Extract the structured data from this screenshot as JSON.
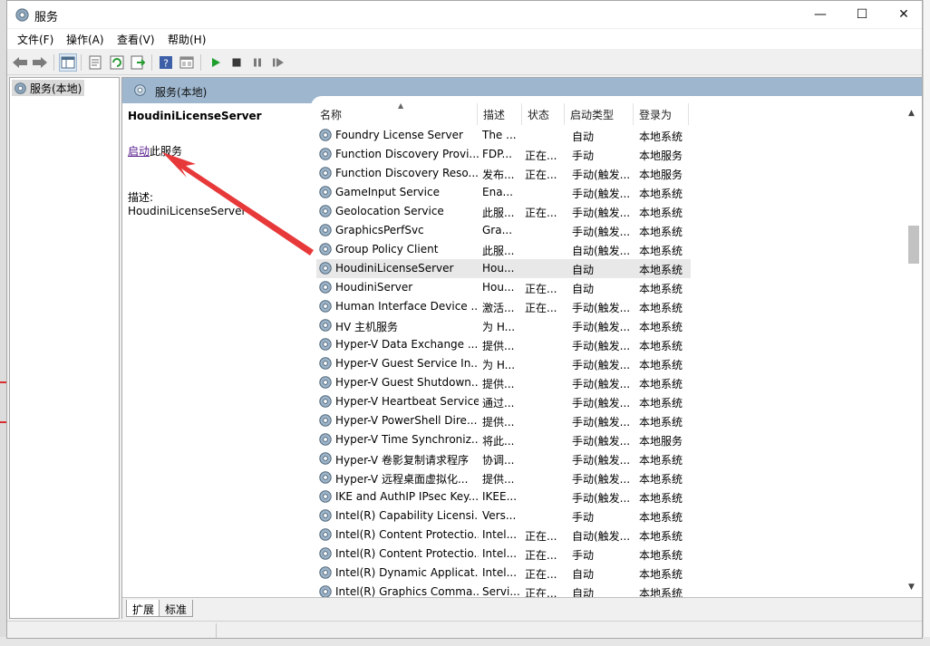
{
  "window": {
    "title": "服务"
  },
  "titlebar_buttons": {
    "minimize": "—",
    "maximize": "☐",
    "close": "✕"
  },
  "menu": [
    {
      "label": "文件(F)"
    },
    {
      "label": "操作(A)"
    },
    {
      "label": "查看(V)"
    },
    {
      "label": "帮助(H)"
    }
  ],
  "toolbar": {
    "icons": [
      "back-icon",
      "forward-icon",
      "show-hide-tree-icon",
      "properties-icon",
      "refresh-icon",
      "export-list-icon",
      "help-icon",
      "view-icon",
      "start-service-icon",
      "stop-service-icon",
      "pause-service-icon",
      "restart-service-icon"
    ]
  },
  "tree": {
    "root": "服务(本地)"
  },
  "pane": {
    "header": "服务(本地)"
  },
  "detail": {
    "service_name": "HoudiniLicenseServer",
    "action_link": "启动",
    "action_suffix": "此服务",
    "desc_label": "描述:",
    "desc_value": "HoudiniLicenseServer"
  },
  "columns": {
    "name": "名称",
    "desc": "描述",
    "status": "状态",
    "startup": "启动类型",
    "logon": "登录为"
  },
  "rows": [
    {
      "name": "Foundry License Server",
      "desc": "The ...",
      "status": "",
      "startup": "自动",
      "logon": "本地系统"
    },
    {
      "name": "Function Discovery Provi...",
      "desc": "FDP...",
      "status": "正在...",
      "startup": "手动",
      "logon": "本地服务"
    },
    {
      "name": "Function Discovery Reso...",
      "desc": "发布...",
      "status": "正在...",
      "startup": "手动(触发...",
      "logon": "本地服务"
    },
    {
      "name": "GameInput Service",
      "desc": "Ena...",
      "status": "",
      "startup": "手动(触发...",
      "logon": "本地系统"
    },
    {
      "name": "Geolocation Service",
      "desc": "此服...",
      "status": "正在...",
      "startup": "手动(触发...",
      "logon": "本地系统"
    },
    {
      "name": "GraphicsPerfSvc",
      "desc": "Gra...",
      "status": "",
      "startup": "手动(触发...",
      "logon": "本地系统"
    },
    {
      "name": "Group Policy Client",
      "desc": "此服...",
      "status": "",
      "startup": "自动(触发...",
      "logon": "本地系统"
    },
    {
      "name": "HoudiniLicenseServer",
      "desc": "Hou...",
      "status": "",
      "startup": "自动",
      "logon": "本地系统"
    },
    {
      "name": "HoudiniServer",
      "desc": "Hou...",
      "status": "正在...",
      "startup": "自动",
      "logon": "本地系统"
    },
    {
      "name": "Human Interface Device ...",
      "desc": "激活...",
      "status": "正在...",
      "startup": "手动(触发...",
      "logon": "本地系统"
    },
    {
      "name": "HV 主机服务",
      "desc": "为 H...",
      "status": "",
      "startup": "手动(触发...",
      "logon": "本地系统"
    },
    {
      "name": "Hyper-V Data Exchange ...",
      "desc": "提供...",
      "status": "",
      "startup": "手动(触发...",
      "logon": "本地系统"
    },
    {
      "name": "Hyper-V Guest Service In...",
      "desc": "为 H...",
      "status": "",
      "startup": "手动(触发...",
      "logon": "本地系统"
    },
    {
      "name": "Hyper-V Guest Shutdown...",
      "desc": "提供...",
      "status": "",
      "startup": "手动(触发...",
      "logon": "本地系统"
    },
    {
      "name": "Hyper-V Heartbeat Service",
      "desc": "通过...",
      "status": "",
      "startup": "手动(触发...",
      "logon": "本地系统"
    },
    {
      "name": "Hyper-V PowerShell Dire...",
      "desc": "提供...",
      "status": "",
      "startup": "手动(触发...",
      "logon": "本地系统"
    },
    {
      "name": "Hyper-V Time Synchroniz...",
      "desc": "将此...",
      "status": "",
      "startup": "手动(触发...",
      "logon": "本地服务"
    },
    {
      "name": "Hyper-V 卷影复制请求程序",
      "desc": "协调...",
      "status": "",
      "startup": "手动(触发...",
      "logon": "本地系统"
    },
    {
      "name": "Hyper-V 远程桌面虚拟化...",
      "desc": "提供...",
      "status": "",
      "startup": "手动(触发...",
      "logon": "本地系统"
    },
    {
      "name": "IKE and AuthIP IPsec Key...",
      "desc": "IKEE...",
      "status": "",
      "startup": "手动(触发...",
      "logon": "本地系统"
    },
    {
      "name": "Intel(R) Capability Licensi...",
      "desc": "Vers...",
      "status": "",
      "startup": "手动",
      "logon": "本地系统"
    },
    {
      "name": "Intel(R) Content Protectio...",
      "desc": "Intel...",
      "status": "正在...",
      "startup": "自动(触发...",
      "logon": "本地系统"
    },
    {
      "name": "Intel(R) Content Protectio...",
      "desc": "Intel...",
      "status": "正在...",
      "startup": "手动",
      "logon": "本地系统"
    },
    {
      "name": "Intel(R) Dynamic Applicat...",
      "desc": "Intel...",
      "status": "正在...",
      "startup": "自动",
      "logon": "本地系统"
    },
    {
      "name": "Intel(R) Graphics Comma...",
      "desc": "Servi...",
      "status": "正在...",
      "startup": "自动",
      "logon": "本地系统"
    }
  ],
  "selected_row": 7,
  "tabs": [
    {
      "label": "扩展"
    },
    {
      "label": "标准"
    }
  ],
  "colors": {
    "pane_header": "#9eb7cf",
    "annotation_arrow": "#e8393a",
    "link": "#551a8b"
  }
}
